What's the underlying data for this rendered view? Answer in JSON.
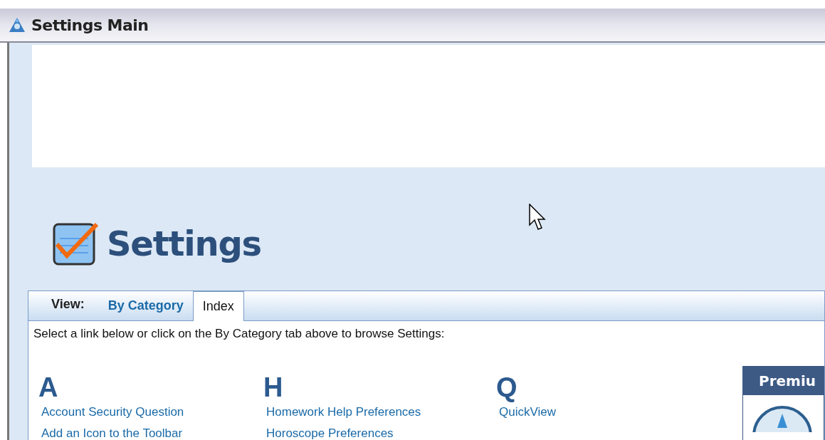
{
  "window": {
    "title": "Settings Main"
  },
  "header": {
    "title": "Settings"
  },
  "view": {
    "label": "View:",
    "tabs": [
      {
        "label": "By Category",
        "selected": false
      },
      {
        "label": "Index",
        "selected": true
      }
    ]
  },
  "intro": "Select a link below or click on the By Category tab above to browse Settings:",
  "index": [
    {
      "letter": "A",
      "links": [
        "Account Security Question",
        "Add an Icon to the Toolbar"
      ]
    },
    {
      "letter": "H",
      "links": [
        "Homework Help Preferences",
        "Horoscope Preferences"
      ]
    },
    {
      "letter": "Q",
      "links": [
        "QuickView"
      ]
    }
  ],
  "premium": {
    "title": "Premiu"
  }
}
